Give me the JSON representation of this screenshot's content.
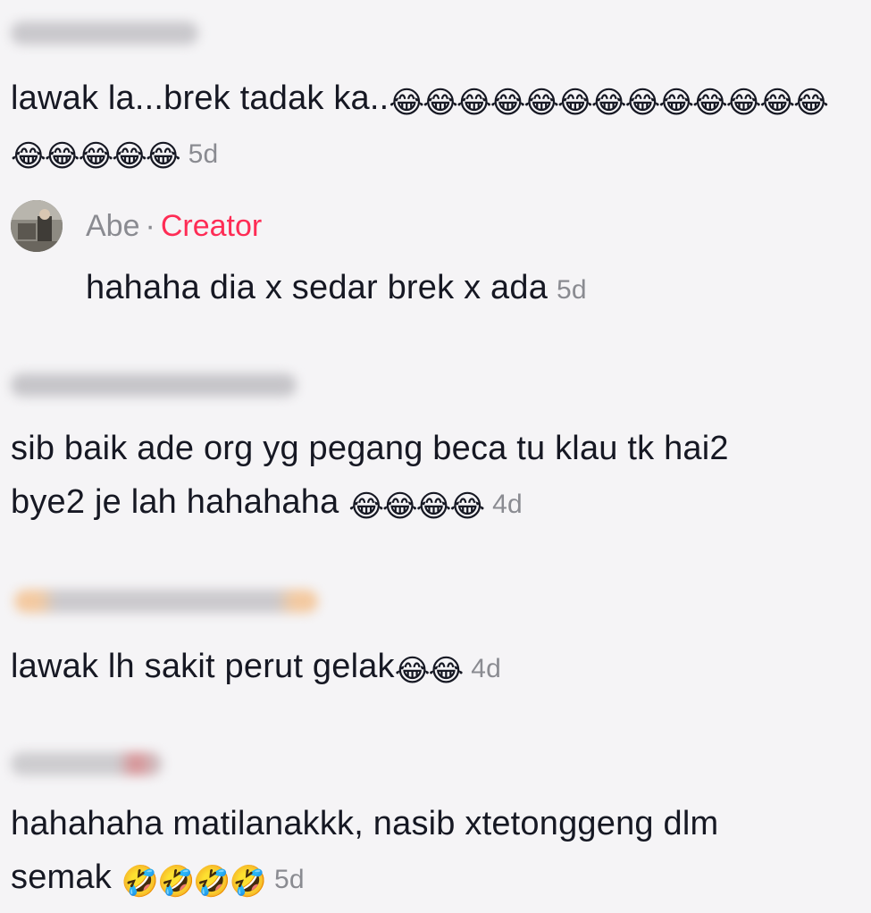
{
  "comments": [
    {
      "text": "lawak la...brek tadak ka..",
      "emoji": "😂😂😂😂😂😂😂😂😂😂😂😂😂😂😂😂😂😂",
      "time": "5d"
    },
    {
      "text": "sib baik ade org yg pegang beca tu klau tk hai2 bye2 je lah hahahaha ",
      "emoji": "😂😂😂😂",
      "time": "4d"
    },
    {
      "text": "lawak lh sakit perut gelak",
      "emoji": "😂😂",
      "time": "4d"
    },
    {
      "text": "hahahaha matilanakkk, nasib xtetonggeng dlm semak ",
      "emoji": "🤣🤣🤣🤣",
      "time": "5d"
    }
  ],
  "reply": {
    "username": "Abe",
    "separator": "·",
    "badge": "Creator",
    "text": "hahaha dia x sedar brek x ada",
    "time": "5d"
  },
  "colors": {
    "background": "#f5f4f6",
    "creator_badge": "#fe2c55",
    "muted": "#8a8b91"
  }
}
